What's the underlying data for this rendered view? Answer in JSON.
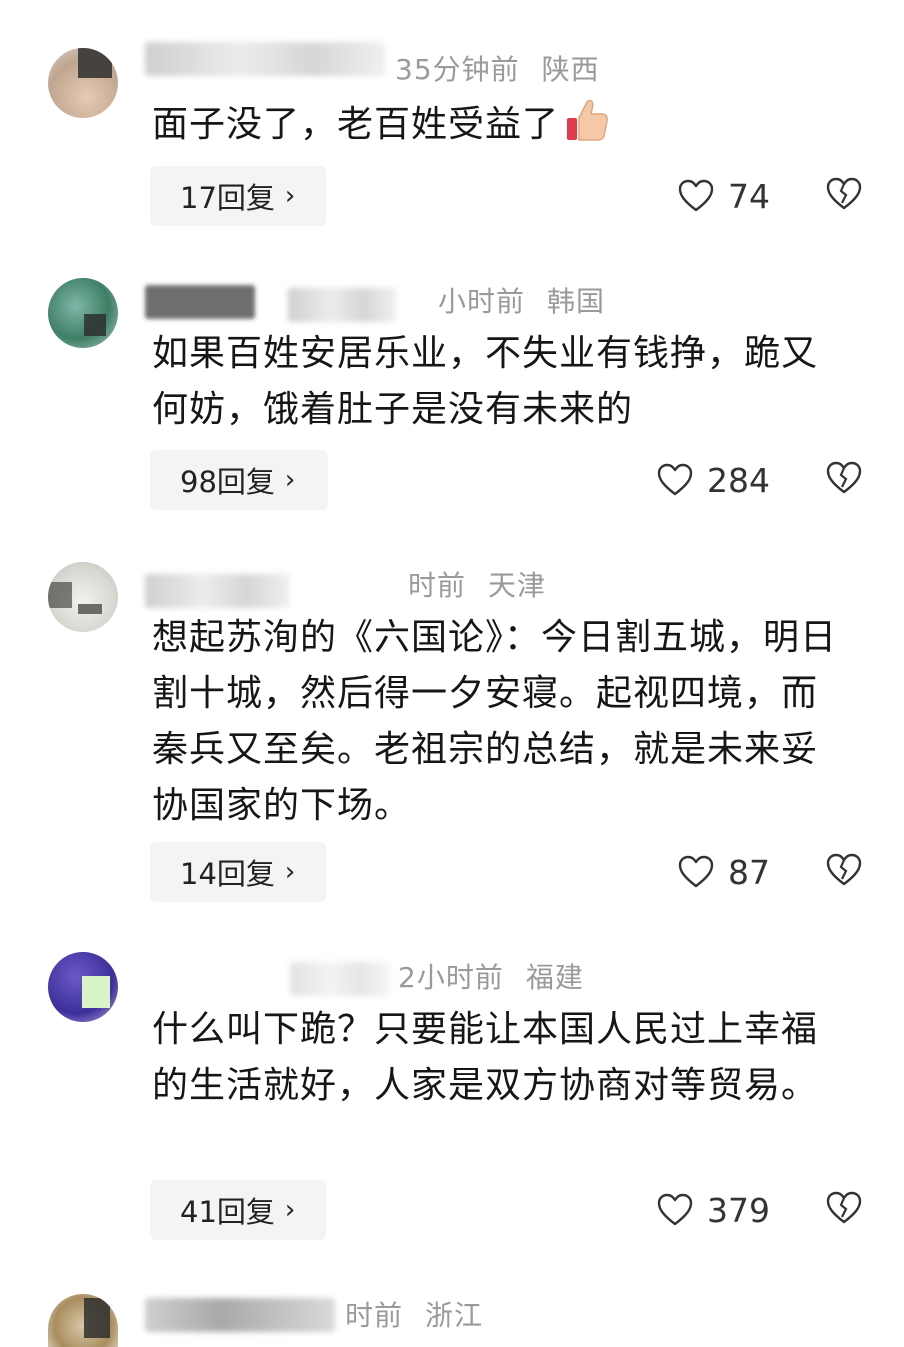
{
  "comments": [
    {
      "time": "35分钟前",
      "location": "陕西",
      "text": "面子没了，老百姓受益了",
      "emoji": "thumbs-up",
      "replies": "17回复",
      "likes": "74"
    },
    {
      "time": "小时前",
      "location": "韩国",
      "text": "如果百姓安居乐业，不失业有钱挣，跪又何妨，饿着肚子是没有未来的",
      "replies": "98回复",
      "likes": "284"
    },
    {
      "time": "时前",
      "location": "天津",
      "text": "想起苏洵的《六国论》：今日割五城，明日割十城，然后得一夕安寝。起视四境，而秦兵又至矣。老祖宗的总结，就是未来妥协国家的下场。",
      "replies": "14回复",
      "likes": "87"
    },
    {
      "time": "2小时前",
      "location": "福建",
      "text": "什么叫下跪？只要能让本国人民过上幸福的生活就好，人家是双方协商对等贸易。",
      "replies": "41回复",
      "likes": "379"
    },
    {
      "time": "时前",
      "location": "浙江"
    }
  ],
  "ui": {
    "chevron": "›"
  }
}
